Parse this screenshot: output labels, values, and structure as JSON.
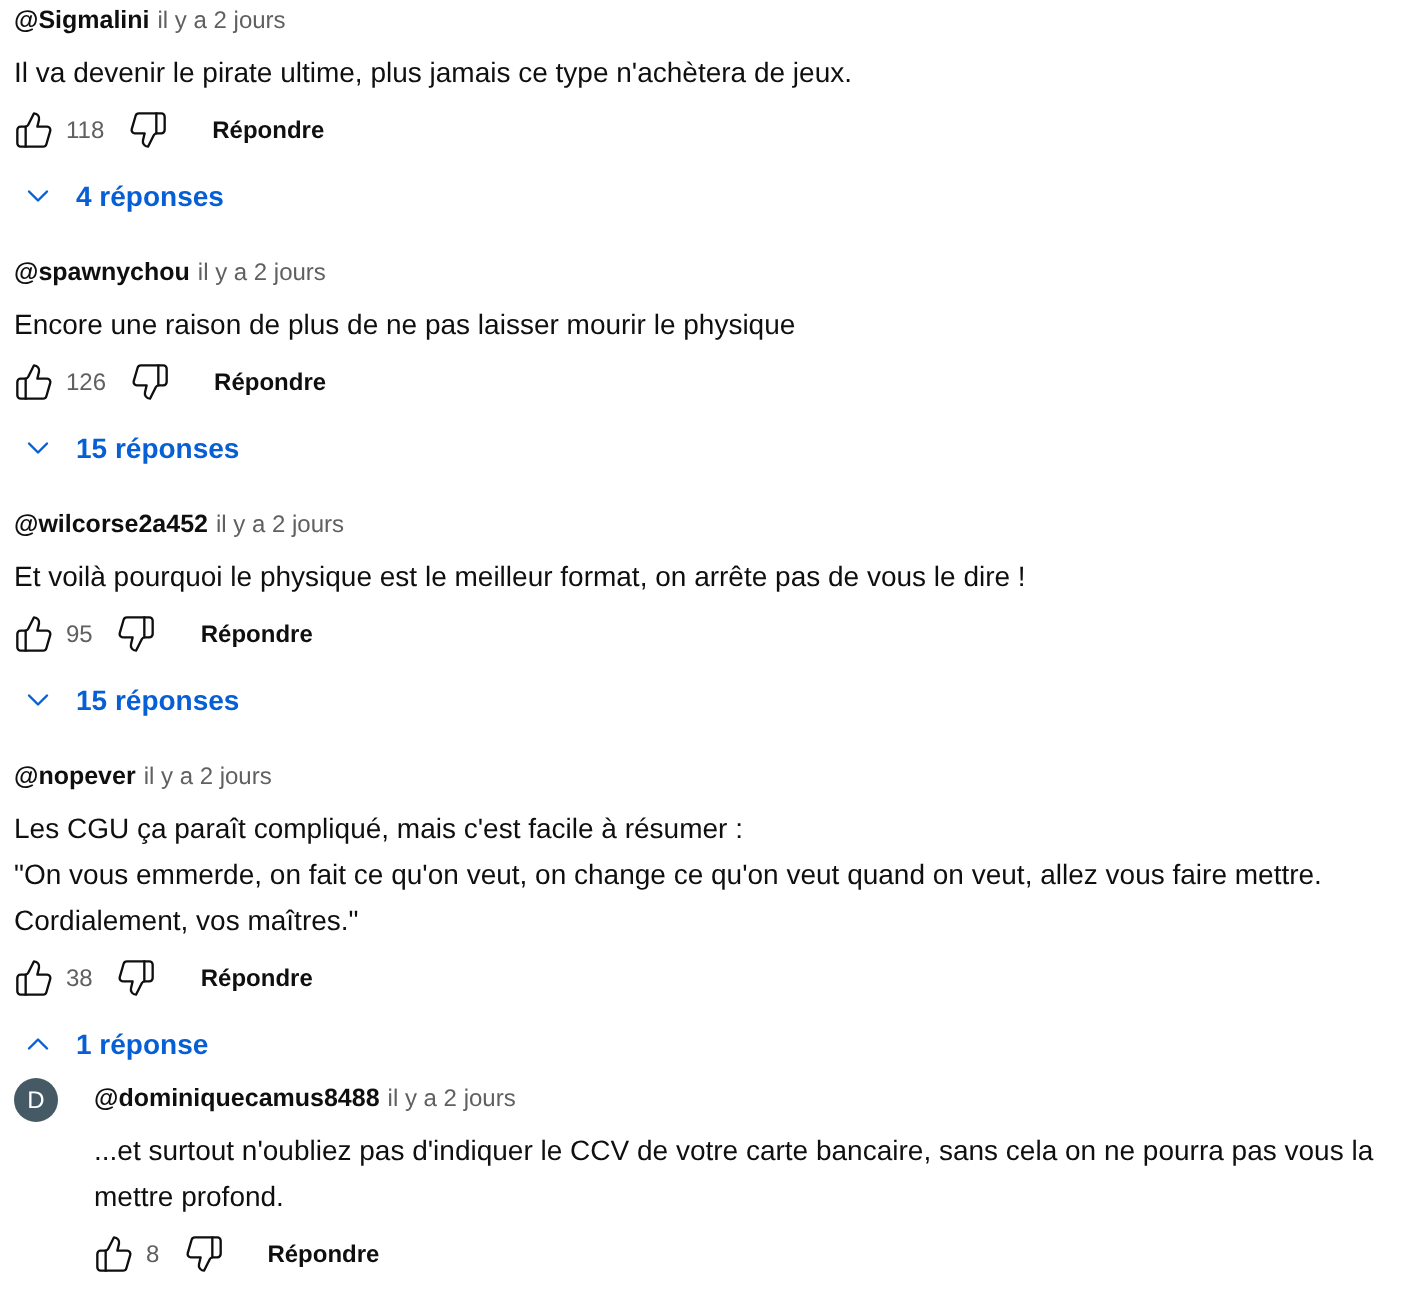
{
  "comments": [
    {
      "author": "@Sigmalini",
      "time": "il y a 2 jours",
      "lines": [
        "Il va devenir le pirate ultime, plus jamais ce type n'achètera de jeux."
      ],
      "likes": "118",
      "reply_label": "Répondre",
      "replies_toggle": {
        "label": "4 réponses",
        "expanded": false
      }
    },
    {
      "author": "@spawnychou",
      "time": "il y a 2 jours",
      "lines": [
        "Encore une raison de plus de ne pas laisser mourir le physique"
      ],
      "likes": "126",
      "reply_label": "Répondre",
      "replies_toggle": {
        "label": "15 réponses",
        "expanded": false
      }
    },
    {
      "author": "@wilcorse2a452",
      "time": "il y a 2 jours",
      "lines": [
        "Et voilà pourquoi le physique est le meilleur format, on arrête pas de vous le dire !"
      ],
      "likes": "95",
      "reply_label": "Répondre",
      "replies_toggle": {
        "label": "15 réponses",
        "expanded": false
      }
    },
    {
      "author": "@nopever",
      "time": "il y a 2 jours",
      "lines": [
        "Les CGU ça paraît compliqué, mais c'est facile à résumer :",
        "\"On vous emmerde, on fait ce qu'on veut, on change ce qu'on veut quand on veut, allez vous faire mettre.",
        "Cordialement, vos maîtres.\""
      ],
      "likes": "38",
      "reply_label": "Répondre",
      "replies_toggle": {
        "label": "1 réponse",
        "expanded": true
      },
      "replies": [
        {
          "avatar": "D",
          "author": "@dominiquecamus8488",
          "time": "il y a 2 jours",
          "lines": [
            "...et surtout n'oubliez pas d'indiquer le CCV de votre carte bancaire, sans cela on ne pourra pas vous la",
            "mettre profond."
          ],
          "likes": "8",
          "reply_label": "Répondre"
        }
      ]
    }
  ]
}
